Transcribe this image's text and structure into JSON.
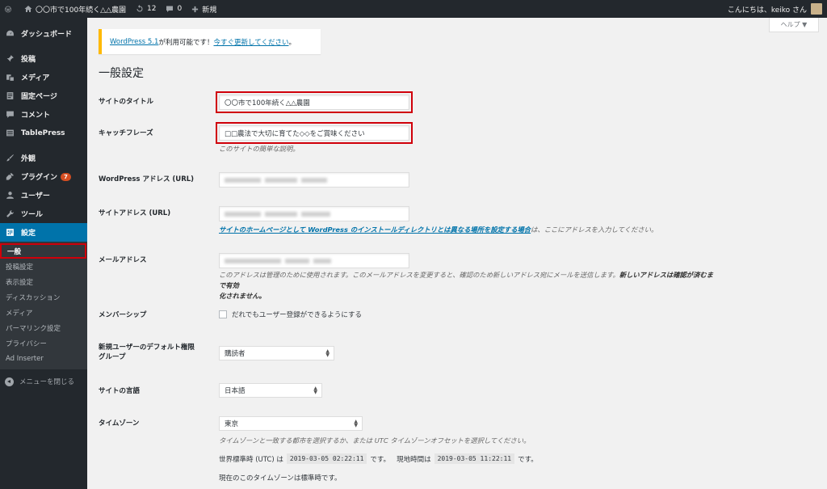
{
  "adminbar": {
    "site_name": "〇〇市で100年続く△△農園",
    "updates_count": "12",
    "comments_count": "0",
    "new_label": "新規",
    "greeting": "こんにちは、keiko さん"
  },
  "sidebar": {
    "items": [
      {
        "label": "ダッシュボード",
        "icon": "dashboard-icon"
      },
      {
        "label": "投稿",
        "icon": "pin-icon"
      },
      {
        "label": "メディア",
        "icon": "media-icon"
      },
      {
        "label": "固定ページ",
        "icon": "page-icon"
      },
      {
        "label": "コメント",
        "icon": "comment-icon"
      },
      {
        "label": "TablePress",
        "icon": "table-icon"
      },
      {
        "label": "外観",
        "icon": "brush-icon"
      },
      {
        "label": "プラグイン",
        "icon": "plugin-icon",
        "badge": "7"
      },
      {
        "label": "ユーザー",
        "icon": "user-icon"
      },
      {
        "label": "ツール",
        "icon": "wrench-icon"
      },
      {
        "label": "設定",
        "icon": "settings-icon"
      }
    ],
    "submenu": [
      "一般",
      "投稿設定",
      "表示設定",
      "ディスカッション",
      "メディア",
      "パーマリンク設定",
      "プライバシー",
      "Ad Inserter"
    ],
    "collapse_label": "メニューを閉じる"
  },
  "help_label": "ヘルプ ▼",
  "notice": {
    "link1": "WordPress 5.1",
    "text": " が利用可能です！",
    "link2": "今すぐ更新してください",
    "end": "。"
  },
  "page_title": "一般設定",
  "form": {
    "site_title_label": "サイトのタイトル",
    "site_title_value": "〇〇市で100年続く△△農園",
    "tagline_label": "キャッチフレーズ",
    "tagline_value": "□□農法で大切に育てた◇◇をご賞味ください",
    "tagline_desc": "このサイトの簡単な説明。",
    "wp_address_label": "WordPress アドレス (URL)",
    "site_address_label": "サイトアドレス (URL)",
    "site_address_desc_link": "サイトのホームページとして WordPress のインストールディレクトリとは異なる場所を設定する場合",
    "site_address_desc_rest": "は、ここにアドレスを入力してください。",
    "email_label": "メールアドレス",
    "email_desc_1": "このアドレスは管理のために使用されます。このメールアドレスを変更すると、確認のため新しいアドレス宛にメールを送信します。",
    "email_desc_bold_1": "新しいアドレスは確認が済むまで有効",
    "email_desc_bold_2": "化されません。",
    "membership_label": "メンバーシップ",
    "membership_checkbox": "だれでもユーザー登録ができるようにする",
    "default_role_label_1": "新規ユーザーのデフォルト権限",
    "default_role_label_2": "グループ",
    "default_role_value": "購読者",
    "language_label": "サイトの言語",
    "language_value": "日本語",
    "timezone_label": "タイムゾーン",
    "timezone_value": "東京",
    "timezone_desc": "タイムゾーンと一致する都市を選択するか、または UTC タイムゾーンオフセットを選択してください。",
    "utc_label": "世界標準時 (UTC) は",
    "utc_time": "2019-03-05 02:22:11",
    "utc_suffix": "です。",
    "local_label": "現地時間は",
    "local_time": "2019-03-05 11:22:11",
    "local_suffix": "です。",
    "tz_standard": "現在のこのタイムゾーンは標準時です。"
  },
  "colors": {
    "admin_dark": "#23282d",
    "accent": "#0073aa",
    "highlight_red": "#d0000a",
    "notice_yellow": "#ffb900",
    "badge_orange": "#d54e21"
  }
}
